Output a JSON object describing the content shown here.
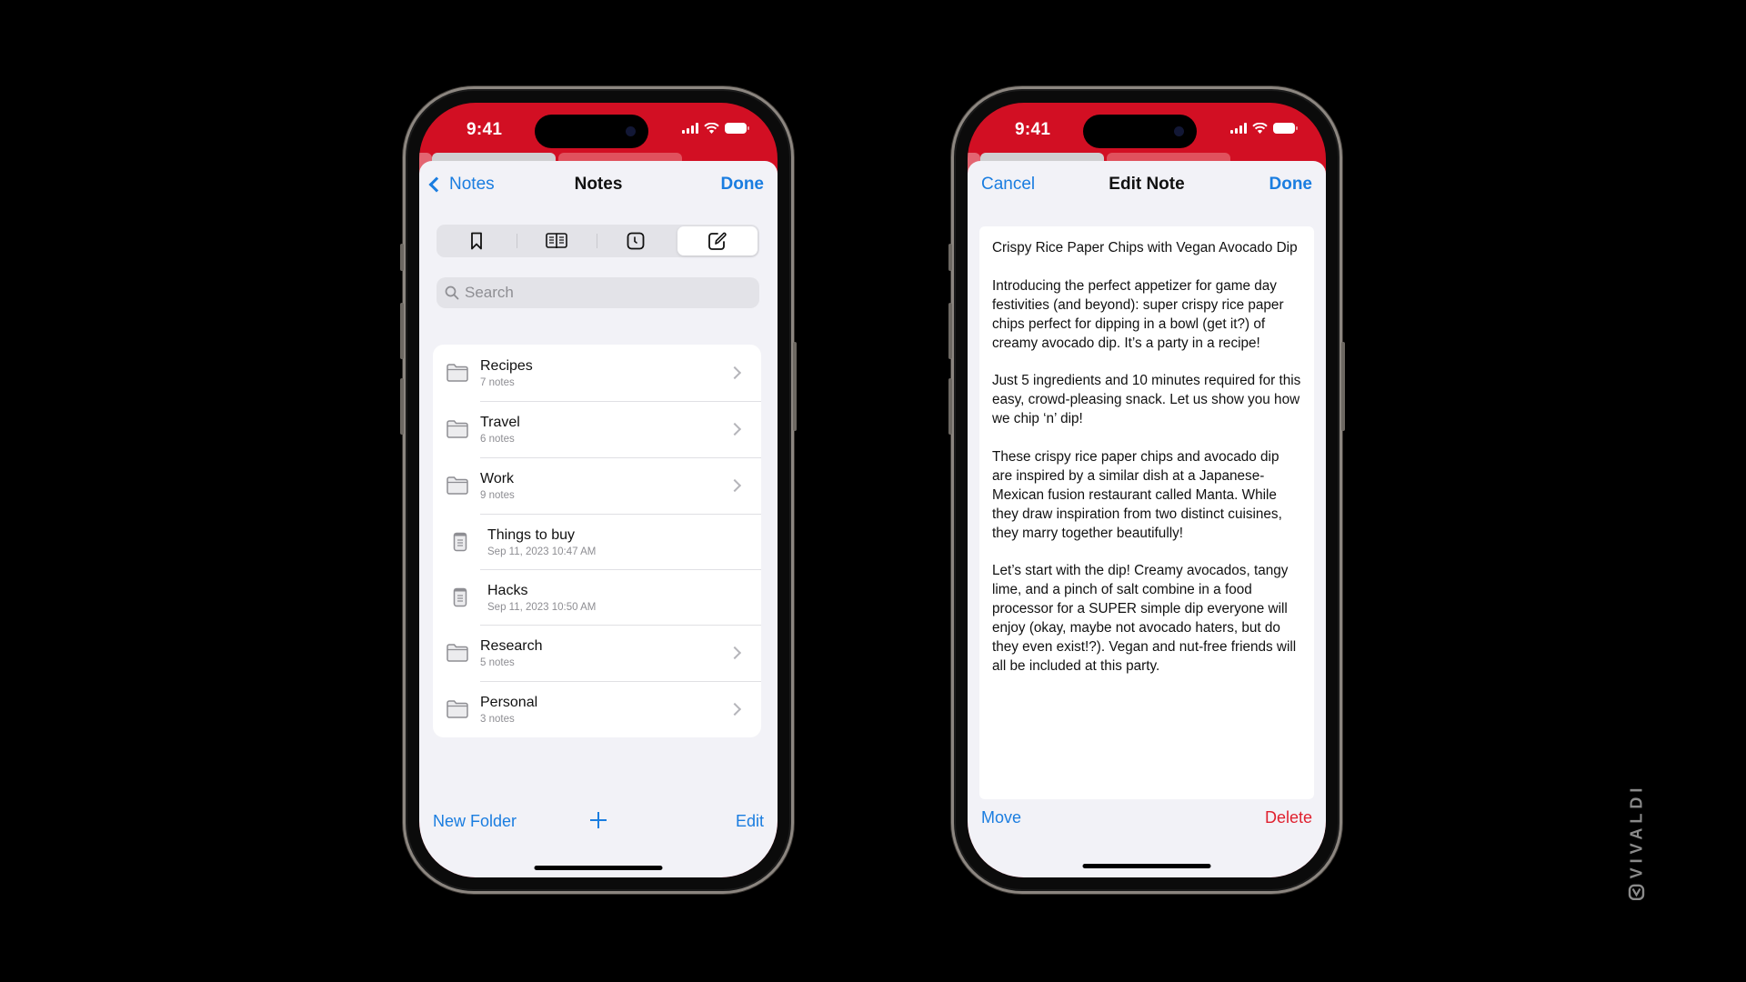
{
  "status_bar": {
    "time": "9:41"
  },
  "left_phone": {
    "navbar": {
      "back_label": "Notes",
      "title": "Notes",
      "done_label": "Done"
    },
    "segments": [
      {
        "icon": "bookmark-icon",
        "active": false
      },
      {
        "icon": "reading-list-icon",
        "active": false
      },
      {
        "icon": "history-icon",
        "active": false
      },
      {
        "icon": "notes-icon",
        "active": true
      }
    ],
    "search": {
      "placeholder": "Search",
      "value": ""
    },
    "items": [
      {
        "type": "folder",
        "title": "Recipes",
        "subtitle": "7 notes"
      },
      {
        "type": "folder",
        "title": "Travel",
        "subtitle": "6 notes"
      },
      {
        "type": "folder",
        "title": "Work",
        "subtitle": "9 notes"
      },
      {
        "type": "note",
        "title": "Things to buy",
        "subtitle": "Sep 11, 2023 10:47 AM"
      },
      {
        "type": "note",
        "title": "Hacks",
        "subtitle": "Sep 11, 2023 10:50 AM"
      },
      {
        "type": "folder",
        "title": "Research",
        "subtitle": "5 notes"
      },
      {
        "type": "folder",
        "title": "Personal",
        "subtitle": "3 notes"
      }
    ],
    "toolbar": {
      "new_folder_label": "New Folder",
      "add_icon": "plus-icon",
      "edit_label": "Edit"
    }
  },
  "right_phone": {
    "navbar": {
      "cancel_label": "Cancel",
      "title": "Edit Note",
      "done_label": "Done"
    },
    "note_text": "Crispy Rice Paper Chips with Vegan Avocado Dip\n\nIntroducing the perfect appetizer for game day festivities (and beyond): super crispy rice paper chips perfect for dipping in a bowl (get it?) of creamy avocado dip. It’s a party in a recipe!\n\nJust 5 ingredients and 10 minutes required for this easy, crowd-pleasing snack. Let us show you how we chip ‘n’ dip!\n\nThese crispy rice paper chips and avocado dip are inspired by a similar dish at a Japanese-Mexican fusion restaurant called Manta. While they draw inspiration from two distinct cuisines, they marry together beautifully!\n\nLet’s start with the dip! Creamy avocados, tangy lime, and a pinch of salt combine in a food processor for a SUPER simple dip everyone will enjoy (okay, maybe not avocado haters, but do they even exist!?). Vegan and nut-free friends will all be included at this party.",
    "toolbar": {
      "move_label": "Move",
      "delete_label": "Delete"
    }
  },
  "branding": {
    "wordmark": "VIVALDI"
  },
  "colors": {
    "accent": "#1a7de0",
    "theme_red": "#d20f23",
    "danger": "#e0202e",
    "sheet_bg": "#f2f2f7"
  }
}
